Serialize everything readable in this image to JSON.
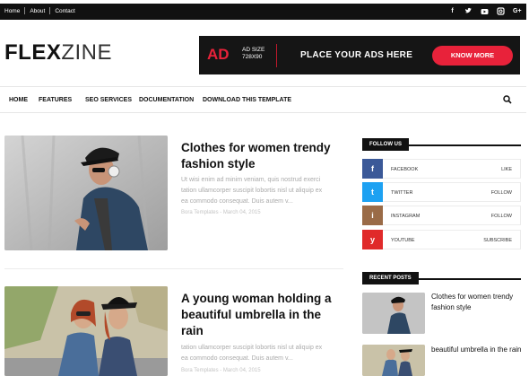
{
  "topbar": {
    "links": [
      "Home",
      "About",
      "Contact"
    ],
    "social_icons": [
      "facebook-icon",
      "twitter-icon",
      "youtube-icon",
      "instagram-icon",
      "google-plus-icon"
    ]
  },
  "header": {
    "logo_bold": "FLEX",
    "logo_light": "ZINE"
  },
  "ad": {
    "big": "AD",
    "size_line1": "AD SIZE",
    "size_line2": "728X90",
    "message": "PLACE YOUR ADS HERE",
    "button": "KNOW MORE",
    "accent": "#e8223a"
  },
  "nav": {
    "items": [
      "HOME",
      "FEATURES",
      "SEO SERVICES",
      "DOCUMENTATION",
      "DOWNLOAD THIS TEMPLATE"
    ],
    "search_icon": "search-icon"
  },
  "posts": [
    {
      "title_line1": "Clothes for women trendy",
      "title_line2": "fashion style",
      "excerpt_line1": "Ut wisi enim ad minim veniam, quis nostrud exerci",
      "excerpt_line2": "tation ullamcorper suscipit lobortis nisl ut aliquip ex",
      "excerpt_line3": "ea commodo consequat. Duis autem v...",
      "meta": "Bora Templates - March 04, 2015"
    },
    {
      "title_line1": "A young woman holding a",
      "title_line2": "beautiful umbrella in the",
      "title_line3": "rain",
      "excerpt_line1": "tation ullamcorper suscipit lobortis nisl ut aliquip ex",
      "excerpt_line2": "ea commodo consequat. Duis autem v...",
      "meta": "Bora Templates - March 04, 2015"
    }
  ],
  "sidebar": {
    "follow_title": "FOLLOW US",
    "follow": [
      {
        "name": "FACEBOOK",
        "action": "LIKE",
        "color": "#3b5998",
        "icon": "f"
      },
      {
        "name": "TWITTER",
        "action": "FOLLOW",
        "color": "#1da1f2",
        "icon": "t"
      },
      {
        "name": "INSTAGRAM",
        "action": "FOLLOW",
        "color": "#9a6b47",
        "icon": "i"
      },
      {
        "name": "YOUTUBE",
        "action": "SUBSCRIBE",
        "color": "#e02a2a",
        "icon": "y"
      }
    ],
    "recent_title": "RECENT POSTS",
    "recent": [
      {
        "title_line1": "Clothes for women trendy",
        "title_line2": "fashion style"
      },
      {
        "title_line1": "beautiful umbrella in the rain"
      }
    ]
  }
}
